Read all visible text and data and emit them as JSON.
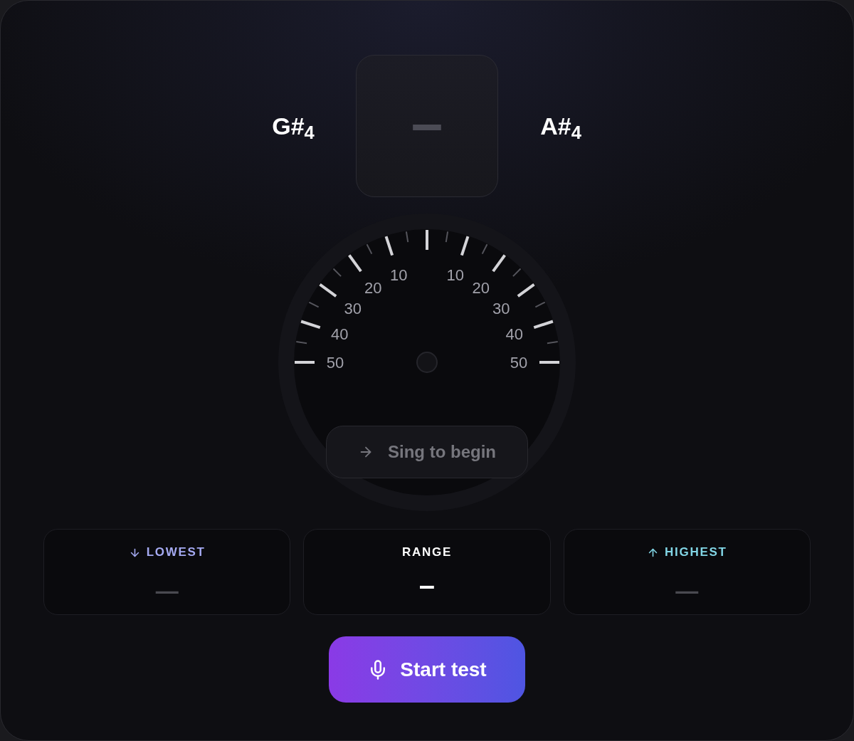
{
  "tuner": {
    "previous_note": "G#$_{4}$",
    "current_note": "–",
    "next_note": "A#$_{4}$"
  },
  "gauge": {
    "left_labels": [
      "10",
      "20",
      "30",
      "40",
      "50"
    ],
    "right_labels": [
      "10",
      "20",
      "30",
      "40",
      "50"
    ],
    "status": "Sing to begin"
  },
  "stats": [
    {
      "kind": "lowest",
      "label": "LOWEST",
      "value": "—",
      "color": "#a5aaf2"
    },
    {
      "kind": "range",
      "label": "RANGE",
      "value": "–",
      "color": "#ffffff"
    },
    {
      "kind": "highest",
      "label": "HIGHEST",
      "value": "—",
      "color": "#82d6e6"
    }
  ],
  "start_button": {
    "label": "Start test"
  }
}
